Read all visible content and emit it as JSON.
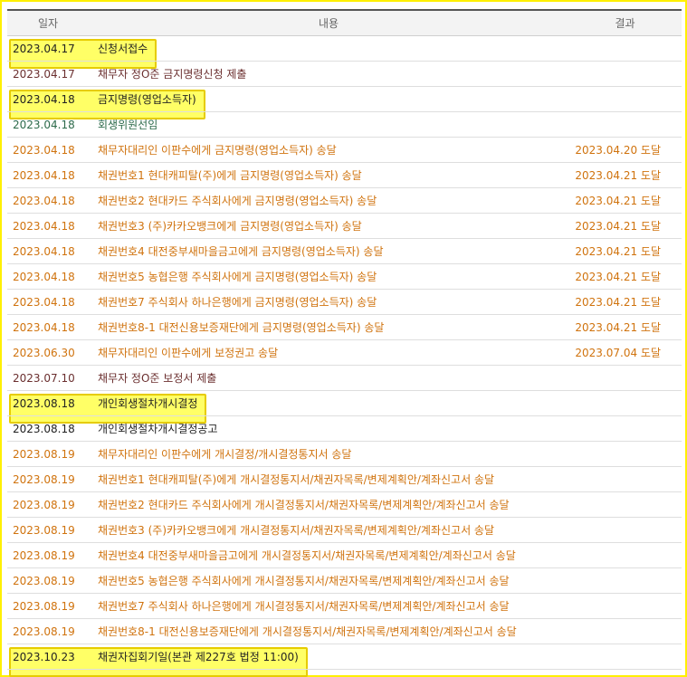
{
  "columns": {
    "date": "일자",
    "content": "내용",
    "result": "결과"
  },
  "colors": {
    "brown": "#6b2f2f",
    "orange": "#d0730e",
    "green": "#2e6b4b",
    "black": "#222222",
    "highlight": "#ffff66"
  },
  "rows": [
    {
      "date": "2023.04.17",
      "content": "신청서접수",
      "result": "",
      "color": "#222222",
      "highlight": true
    },
    {
      "date": "2023.04.17",
      "content": "채무자 정O준 금지명령신청 제출",
      "result": "",
      "color": "#6b2f2f",
      "highlight": false
    },
    {
      "date": "2023.04.18",
      "content": "금지명령(영업소득자)",
      "result": "",
      "color": "#222222",
      "highlight": true
    },
    {
      "date": "2023.04.18",
      "content": "회생위원선임",
      "result": "",
      "color": "#2e6b4b",
      "highlight": false
    },
    {
      "date": "2023.04.18",
      "content": "채무자대리인 이판수에게 금지명령(영업소득자) 송달",
      "result": "2023.04.20 도달",
      "color": "#d0730e",
      "highlight": false
    },
    {
      "date": "2023.04.18",
      "content": "채권번호1 현대캐피탈(주)에게 금지명령(영업소득자) 송달",
      "result": "2023.04.21 도달",
      "color": "#d0730e",
      "highlight": false
    },
    {
      "date": "2023.04.18",
      "content": "채권번호2 현대카드 주식회사에게 금지명령(영업소득자) 송달",
      "result": "2023.04.21 도달",
      "color": "#d0730e",
      "highlight": false
    },
    {
      "date": "2023.04.18",
      "content": "채권번호3 (주)카카오뱅크에게 금지명령(영업소득자) 송달",
      "result": "2023.04.21 도달",
      "color": "#d0730e",
      "highlight": false
    },
    {
      "date": "2023.04.18",
      "content": "채권번호4 대전중부새마을금고에게 금지명령(영업소득자) 송달",
      "result": "2023.04.21 도달",
      "color": "#d0730e",
      "highlight": false
    },
    {
      "date": "2023.04.18",
      "content": "채권번호5 농협은행 주식회사에게 금지명령(영업소득자) 송달",
      "result": "2023.04.21 도달",
      "color": "#d0730e",
      "highlight": false
    },
    {
      "date": "2023.04.18",
      "content": "채권번호7 주식회사 하나은행에게 금지명령(영업소득자) 송달",
      "result": "2023.04.21 도달",
      "color": "#d0730e",
      "highlight": false
    },
    {
      "date": "2023.04.18",
      "content": "채권번호8-1 대전신용보증재단에게 금지명령(영업소득자) 송달",
      "result": "2023.04.21 도달",
      "color": "#d0730e",
      "highlight": false
    },
    {
      "date": "2023.06.30",
      "content": "채무자대리인 이판수에게 보정권고 송달",
      "result": "2023.07.04 도달",
      "color": "#d0730e",
      "highlight": false
    },
    {
      "date": "2023.07.10",
      "content": "채무자 정O준 보정서 제출",
      "result": "",
      "color": "#6b2f2f",
      "highlight": false
    },
    {
      "date": "2023.08.18",
      "content": "개인회생절차개시결정",
      "result": "",
      "color": "#222222",
      "highlight": true
    },
    {
      "date": "2023.08.18",
      "content": "개인회생절차개시결정공고",
      "result": "",
      "color": "#222222",
      "highlight": false
    },
    {
      "date": "2023.08.19",
      "content": "채무자대리인 이판수에게 개시결정/개시결정통지서 송달",
      "result": "",
      "color": "#d0730e",
      "highlight": false
    },
    {
      "date": "2023.08.19",
      "content": "채권번호1 현대캐피탈(주)에게 개시결정통지서/채권자목록/변제계획안/계좌신고서 송달",
      "result": "",
      "color": "#d0730e",
      "highlight": false
    },
    {
      "date": "2023.08.19",
      "content": "채권번호2 현대카드 주식회사에게 개시결정통지서/채권자목록/변제계획안/계좌신고서 송달",
      "result": "",
      "color": "#d0730e",
      "highlight": false
    },
    {
      "date": "2023.08.19",
      "content": "채권번호3 (주)카카오뱅크에게 개시결정통지서/채권자목록/변제계획안/계좌신고서 송달",
      "result": "",
      "color": "#d0730e",
      "highlight": false
    },
    {
      "date": "2023.08.19",
      "content": "채권번호4 대전중부새마을금고에게 개시결정통지서/채권자목록/변제계획안/계좌신고서 송달",
      "result": "",
      "color": "#d0730e",
      "highlight": false
    },
    {
      "date": "2023.08.19",
      "content": "채권번호5 농협은행 주식회사에게 개시결정통지서/채권자목록/변제계획안/계좌신고서 송달",
      "result": "",
      "color": "#d0730e",
      "highlight": false
    },
    {
      "date": "2023.08.19",
      "content": "채권번호7 주식회사 하나은행에게 개시결정통지서/채권자목록/변제계획안/계좌신고서 송달",
      "result": "",
      "color": "#d0730e",
      "highlight": false
    },
    {
      "date": "2023.08.19",
      "content": "채권번호8-1 대전신용보증재단에게 개시결정통지서/채권자목록/변제계획안/계좌신고서 송달",
      "result": "",
      "color": "#d0730e",
      "highlight": false
    },
    {
      "date": "2023.10.23",
      "content": "채권자집회기일(본관 제227호 법정 11:00)",
      "result": "",
      "color": "#222222",
      "highlight": true
    }
  ]
}
